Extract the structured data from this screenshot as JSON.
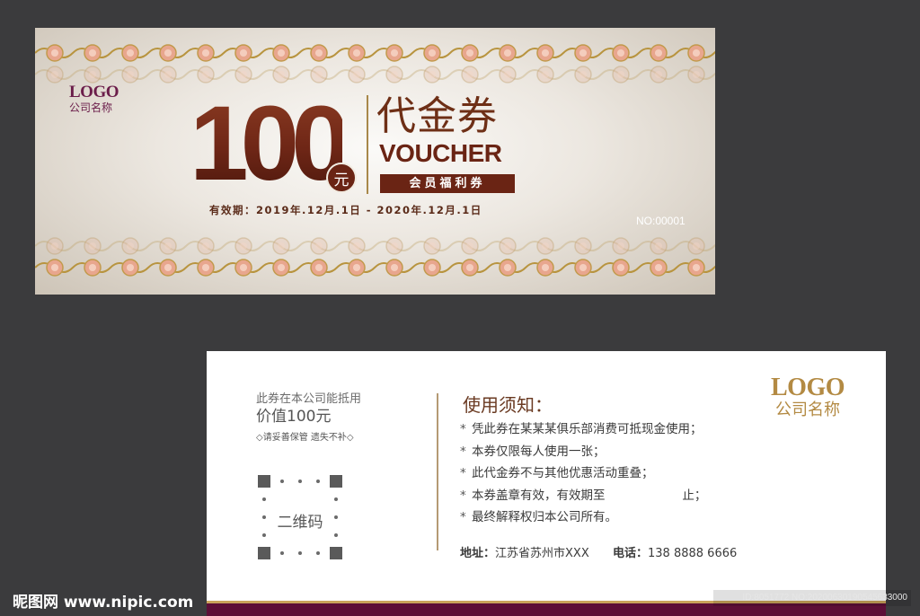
{
  "front": {
    "logo": "LOGO",
    "company": "公司名称",
    "amount": "100",
    "currency_badge": "元",
    "title_cn": "代金券",
    "title_en": "VOUCHER",
    "member_tag": "会员福利券",
    "validity": "有效期：2019年.12月.1日 - 2020年.12月.1日",
    "serial": "NO:00001",
    "colors": {
      "accent": "#6a2414",
      "logo": "#6b1d4a",
      "gold": "#a8884a"
    },
    "ornament": "flower-scroll-border"
  },
  "back": {
    "left_line1": "此券在本公司能抵用",
    "left_line2": "价值100元",
    "left_line3": "◇请妥善保管 遗失不补◇",
    "qr_label": "二维码",
    "rules_title": "使用须知：",
    "rules": [
      "凭此券在某某某俱乐部消费可抵现金使用；",
      "本券仅限每人使用一张；",
      "此代金券不与其他优惠活动重叠；",
      "本券盖章有效，有效期至                    止；",
      "最终解释权归本公司所有。"
    ],
    "bullet": "*",
    "address_label": "地址：",
    "address": "江苏省苏州市XXX",
    "phone_label": "电话：",
    "phone": "138 8888 6666",
    "logo": "LOGO",
    "company": "公司名称",
    "colors": {
      "bar": "#5d0e37",
      "logo": "#b38a43"
    }
  },
  "watermark": {
    "site": "昵图网 www.nipic.com",
    "id": "ID:8051772 NO:20200630190545633000"
  }
}
